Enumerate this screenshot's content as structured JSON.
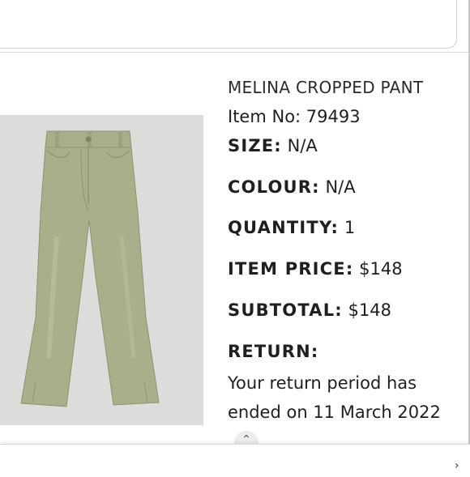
{
  "product": {
    "name": "MELINA CROPPED PANT",
    "item_no": "Item No: 79493",
    "image_icon": "cropped-pant-icon",
    "fields": {
      "size": {
        "label": "SIZE:",
        "value": "N/A"
      },
      "colour": {
        "label": "COLOUR:",
        "value": "N/A"
      },
      "quantity": {
        "label": "QUANTITY:",
        "value": "1"
      },
      "item_price": {
        "label": "ITEM PRICE:",
        "value": "$148"
      },
      "subtotal": {
        "label": "SUBTOTAL:",
        "value": "$148"
      }
    },
    "return": {
      "label": "RETURN:",
      "message": "Your return period has ended on 11 March 2022"
    }
  },
  "colors": {
    "pant_fill": "#a7b08a",
    "pant_shade": "#8c9570",
    "image_bg": "#dcdddb"
  },
  "bottom": {
    "scroll_icon": "chevron-up-icon",
    "corner_icon": "chevron-icon"
  }
}
